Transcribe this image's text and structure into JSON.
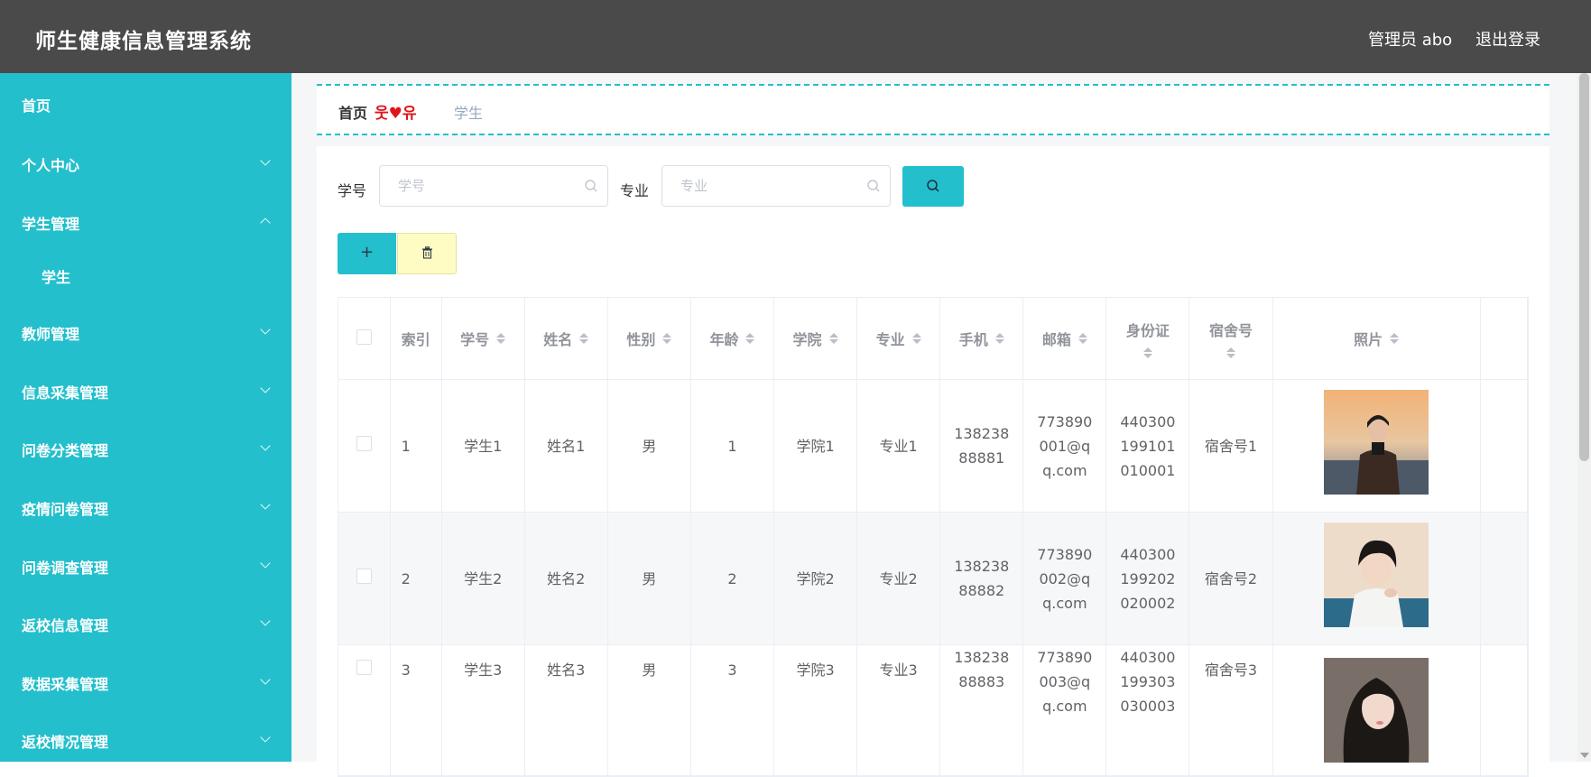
{
  "header": {
    "title": "师生健康信息管理系统",
    "user": "管理员 abo",
    "logout": "退出登录"
  },
  "sidebar": {
    "items": [
      {
        "label": "首页",
        "arrow": "none"
      },
      {
        "label": "个人中心",
        "arrow": "down"
      },
      {
        "label": "学生管理",
        "arrow": "up"
      },
      {
        "label": "学生",
        "arrow": "none",
        "sub": true
      },
      {
        "label": "教师管理",
        "arrow": "down"
      },
      {
        "label": "信息采集管理",
        "arrow": "down"
      },
      {
        "label": "问卷分类管理",
        "arrow": "down"
      },
      {
        "label": "疫情问卷管理",
        "arrow": "down"
      },
      {
        "label": "问卷调查管理",
        "arrow": "down"
      },
      {
        "label": "返校信息管理",
        "arrow": "down"
      },
      {
        "label": "数据采集管理",
        "arrow": "down"
      },
      {
        "label": "返校情况管理",
        "arrow": "down"
      }
    ]
  },
  "breadcrumb": {
    "home": "首页",
    "separator": "웃♥유",
    "current": "学生"
  },
  "search": {
    "student_no_label": "学号",
    "student_no_placeholder": "学号",
    "major_label": "专业",
    "major_placeholder": "专业"
  },
  "actions": {
    "add_label": "+"
  },
  "table": {
    "columns": [
      "索引",
      "学号",
      "姓名",
      "性别",
      "年龄",
      "学院",
      "专业",
      "手机",
      "邮箱",
      "身份证",
      "宿舍号",
      "照片"
    ],
    "rows": [
      {
        "index": "1",
        "no": "学生1",
        "name": "姓名1",
        "gender": "男",
        "age": "1",
        "college": "学院1",
        "major": "专业1",
        "phone": "13823888881",
        "email": "773890001@qq.com",
        "id_card": "440300199101010001",
        "dorm": "宿舍号1"
      },
      {
        "index": "2",
        "no": "学生2",
        "name": "姓名2",
        "gender": "男",
        "age": "2",
        "college": "学院2",
        "major": "专业2",
        "phone": "13823888882",
        "email": "773890002@qq.com",
        "id_card": "440300199202020002",
        "dorm": "宿舍号2"
      },
      {
        "index": "3",
        "no": "学生3",
        "name": "姓名3",
        "gender": "男",
        "age": "3",
        "college": "学院3",
        "major": "专业3",
        "phone": "13823888883",
        "email": "773890003@qq.com",
        "id_card": "440300199303030003",
        "dorm": "宿舍号3"
      }
    ]
  },
  "colors": {
    "accent": "#23bfcc",
    "header_bg": "#4a4a4a",
    "breadcrumb_separator": "#e0151b",
    "delete_bg": "#fefcc3"
  }
}
